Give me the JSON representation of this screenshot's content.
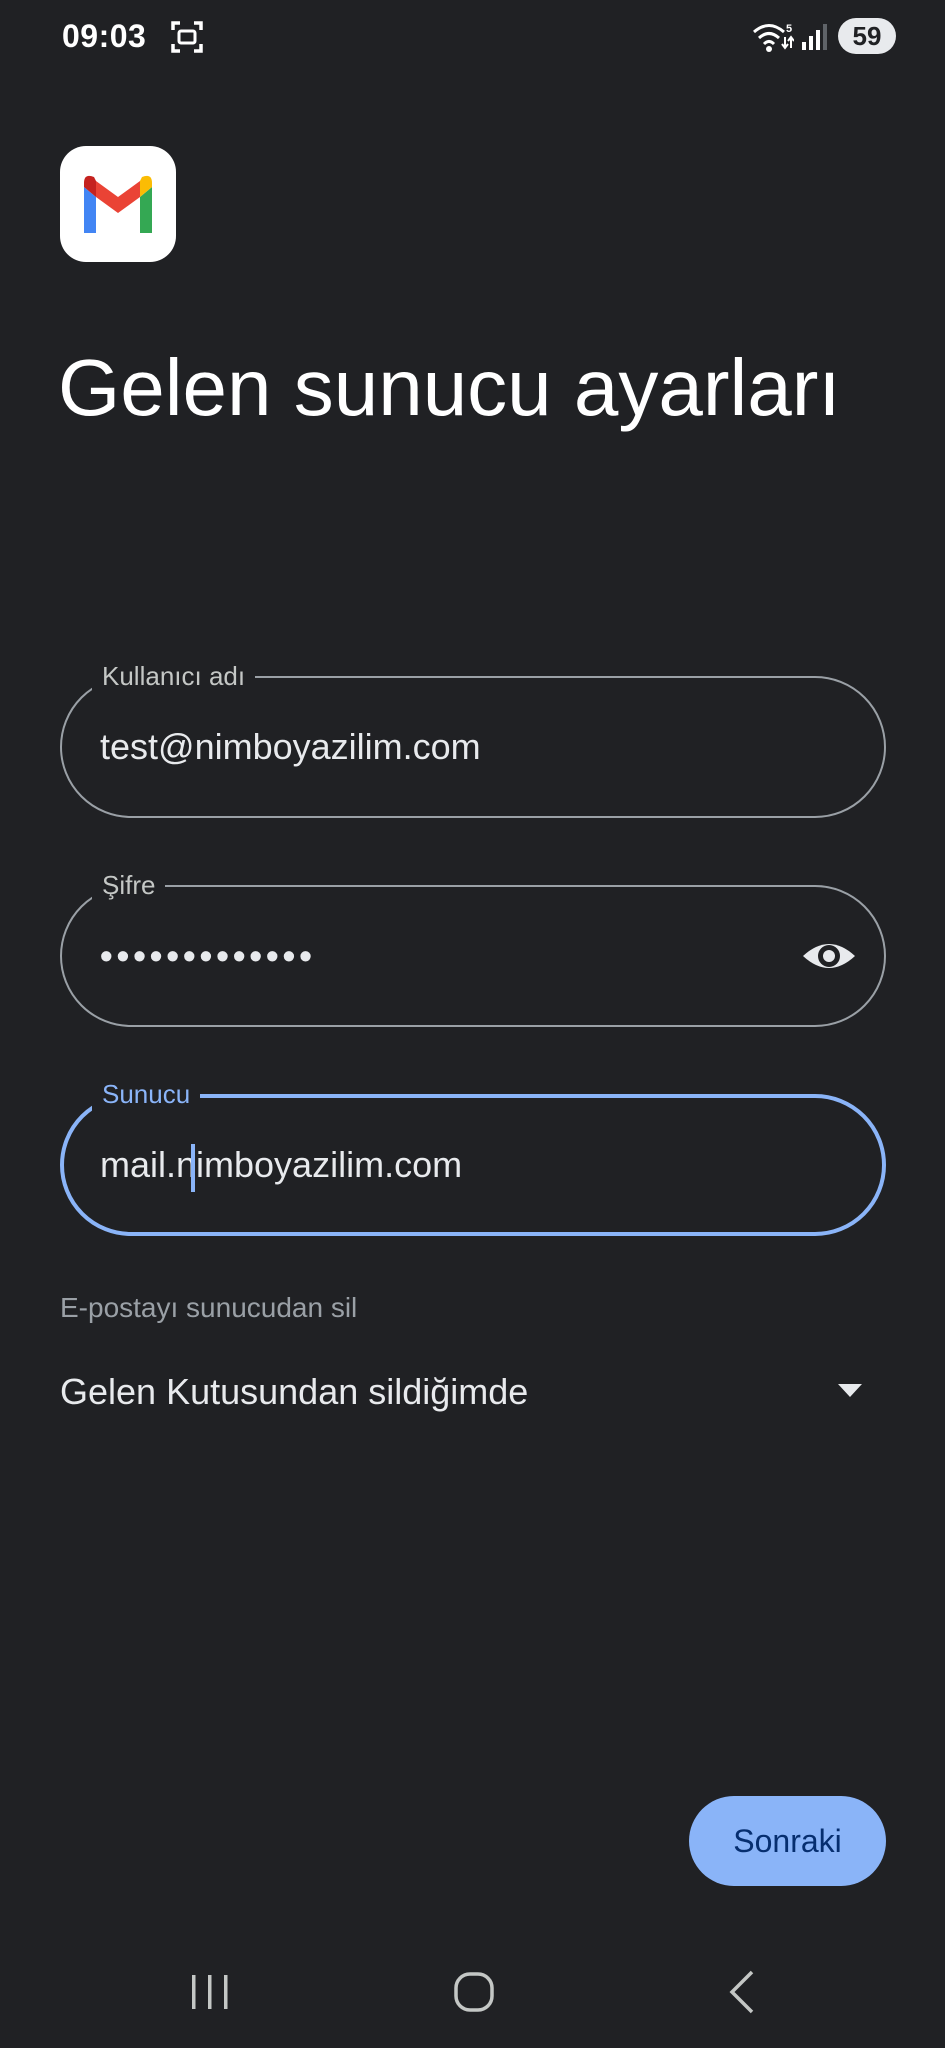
{
  "status_bar": {
    "time": "09:03",
    "battery": "59",
    "icons": [
      "screenshot-icon",
      "wifi-icon",
      "signal-icon",
      "battery-icon"
    ]
  },
  "app": {
    "logo": "gmail-logo-icon"
  },
  "page": {
    "title": "Gelen sunucu ayarları"
  },
  "fields": {
    "username": {
      "label": "Kullanıcı adı",
      "value": "test@nimboyazilim.com"
    },
    "password": {
      "label": "Şifre",
      "value": "•••••••••••••",
      "toggle_icon": "eye-icon"
    },
    "server": {
      "label": "Sunucu",
      "value": "mail.nimboyazilim.com"
    }
  },
  "delete_from_server": {
    "label": "E-postayı sunucudan sil",
    "selected": "Gelen Kutusundan sildiğimde",
    "icon": "dropdown-arrow-icon"
  },
  "actions": {
    "next_label": "Sonraki"
  },
  "nav_bar": {
    "buttons": [
      "recents-icon",
      "home-icon",
      "back-icon"
    ]
  },
  "colors": {
    "background": "#202124",
    "accent": "#8ab4f8",
    "outline": "#9aa0a6",
    "text": "#e8eaed"
  }
}
